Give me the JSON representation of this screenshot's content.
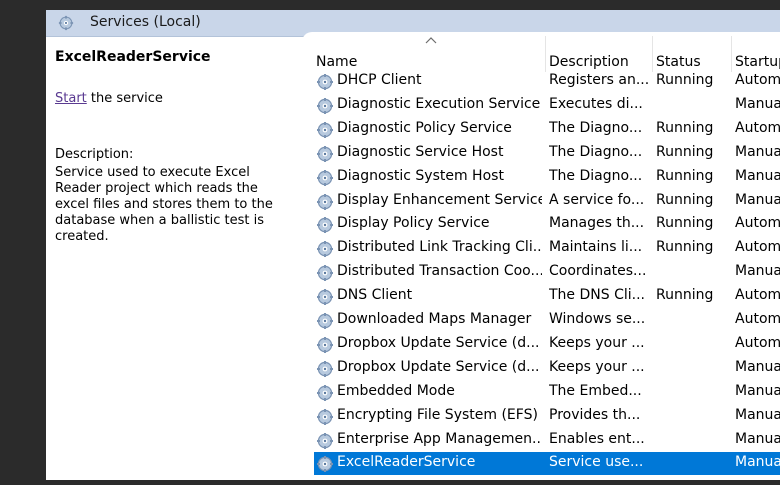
{
  "window": {
    "title": "Services (Local)"
  },
  "left_pane": {
    "service_name": "ExcelReaderService",
    "start_link": "Start",
    "start_suffix": " the service",
    "description_label": "Description:",
    "description_text": "Service used to execute Excel Reader project which reads the excel files and stores them to the database when a ballistic test is created."
  },
  "columns": {
    "name": "Name",
    "description": "Description",
    "status": "Status",
    "startup": "Startup"
  },
  "services": [
    {
      "name": "DHCP Client",
      "description": "Registers an...",
      "status": "Running",
      "startup": "Autom"
    },
    {
      "name": "Diagnostic Execution Service",
      "description": "Executes di...",
      "status": "",
      "startup": "Manua"
    },
    {
      "name": "Diagnostic Policy Service",
      "description": "The Diagno...",
      "status": "Running",
      "startup": "Autom"
    },
    {
      "name": "Diagnostic Service Host",
      "description": "The Diagno...",
      "status": "Running",
      "startup": "Manua"
    },
    {
      "name": "Diagnostic System Host",
      "description": "The Diagno...",
      "status": "Running",
      "startup": "Manua"
    },
    {
      "name": "Display Enhancement Service",
      "description": "A service fo...",
      "status": "Running",
      "startup": "Manua"
    },
    {
      "name": "Display Policy Service",
      "description": "Manages th...",
      "status": "Running",
      "startup": "Autom"
    },
    {
      "name": "Distributed Link Tracking Cli...",
      "description": "Maintains li...",
      "status": "Running",
      "startup": "Autom"
    },
    {
      "name": "Distributed Transaction Coo...",
      "description": "Coordinates...",
      "status": "",
      "startup": "Manua"
    },
    {
      "name": "DNS Client",
      "description": "The DNS Cli...",
      "status": "Running",
      "startup": "Autom"
    },
    {
      "name": "Downloaded Maps Manager",
      "description": "Windows se...",
      "status": "",
      "startup": "Autom"
    },
    {
      "name": "Dropbox Update Service (d...",
      "description": "Keeps your ...",
      "status": "",
      "startup": "Autom"
    },
    {
      "name": "Dropbox Update Service (d...",
      "description": "Keeps your ...",
      "status": "",
      "startup": "Manua"
    },
    {
      "name": "Embedded Mode",
      "description": "The Embed...",
      "status": "",
      "startup": "Manua"
    },
    {
      "name": "Encrypting File System (EFS)",
      "description": "Provides th...",
      "status": "",
      "startup": "Manua"
    },
    {
      "name": "Enterprise App Managemen...",
      "description": "Enables ent...",
      "status": "",
      "startup": "Manua"
    },
    {
      "name": "ExcelReaderService",
      "description": "Service use...",
      "status": "",
      "startup": "Manua",
      "selected": true
    }
  ],
  "colors": {
    "selection": "#0078d7",
    "titlebar": "#c9d6e9",
    "link": "#5a3a91"
  },
  "icons": {
    "title": "services-gear-icon",
    "row": "service-gear-icon"
  }
}
